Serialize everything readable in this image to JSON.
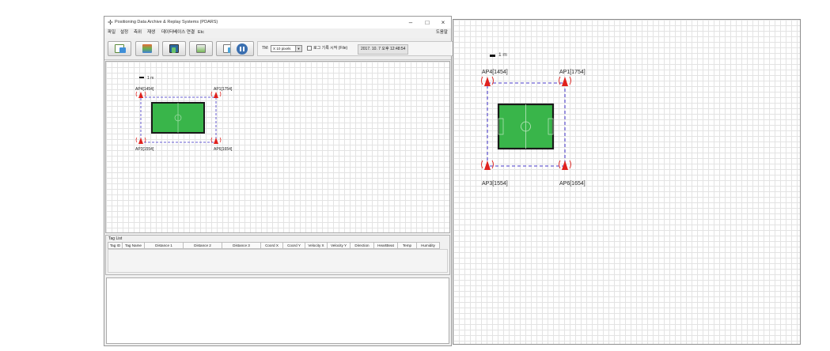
{
  "window": {
    "title": "Positioning Data Archive & Replay Systems (PDARS)",
    "controls": [
      "–",
      "□",
      "×"
    ]
  },
  "menu": {
    "items": [
      "파일",
      "설정",
      "측위",
      "재생",
      "데이터베이스 연결",
      "Etc"
    ],
    "help": "도움말"
  },
  "toolbar": {
    "tm_label": "TM:",
    "tm_value": "X 10 pixels",
    "log_label": "로그 기록 시작 (File)",
    "datetime": "2017. 10. 7 오후 12:48:54"
  },
  "map": {
    "scale_label": "1 m",
    "access_points": [
      {
        "label": "AP4[1454]"
      },
      {
        "label": "AP1[1754]"
      },
      {
        "label": "AP3[1554]"
      },
      {
        "label": "AP6[1654]"
      }
    ]
  },
  "tag_list": {
    "title": "Tag List",
    "columns": [
      "Tag ID",
      "Tag Name",
      "Distance 1",
      "Distance 2",
      "Distance 3",
      "Coord X",
      "Coord Y",
      "Velocity X",
      "Velocity Y",
      "Direction",
      "HeartBeat",
      "Temp",
      "Humidity"
    ]
  },
  "colors": {
    "ap": "#e0211d",
    "boundary": "#6a5fd3",
    "field": "#39b54a",
    "field_border": "#1a1a1a"
  },
  "icons": {
    "app": "crosshair-icon",
    "ap": "wifi-antenna-icon"
  }
}
